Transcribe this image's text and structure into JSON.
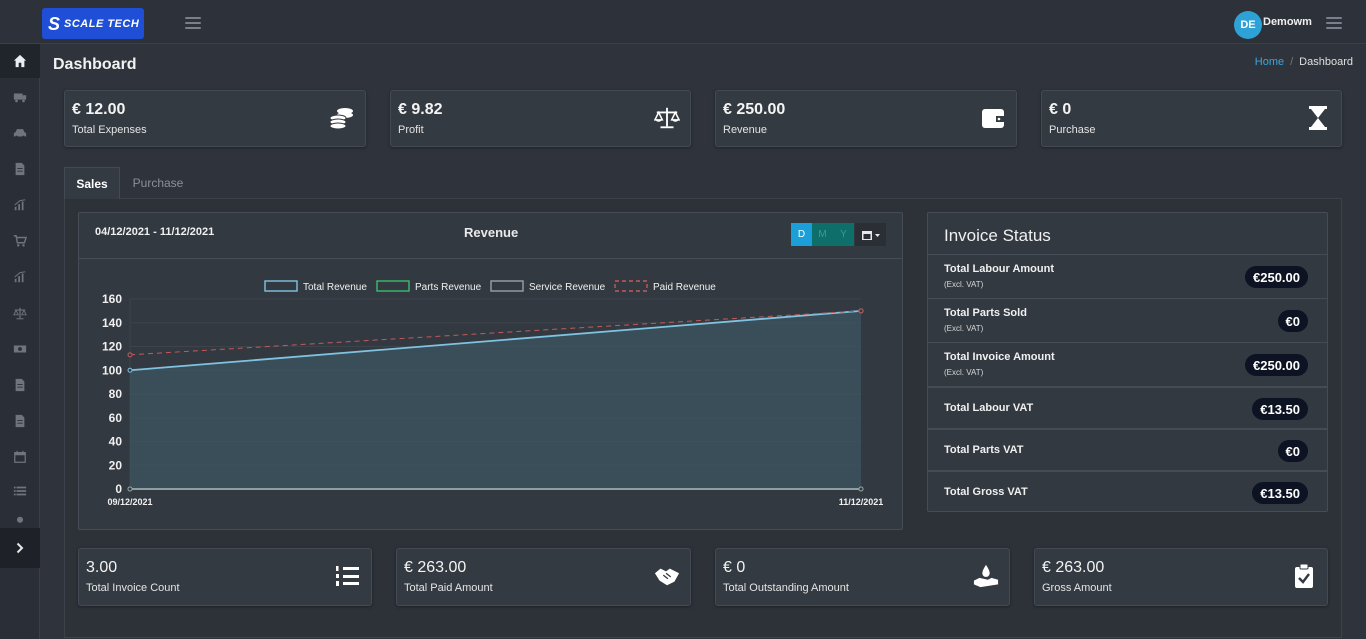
{
  "brand": {
    "name": "SCALE TECH",
    "mark": "S"
  },
  "user": {
    "initials": "DE",
    "name": "Demowm"
  },
  "page": {
    "title": "Dashboard"
  },
  "breadcrumb": {
    "home": "Home",
    "separator": "/",
    "current": "Dashboard"
  },
  "stats_top": [
    {
      "value": "€ 12.00",
      "label": "Total Expenses",
      "icon": "coins-icon"
    },
    {
      "value": "€ 9.82",
      "label": "Profit",
      "icon": "balance-scale-icon"
    },
    {
      "value": "€ 250.00",
      "label": "Revenue",
      "icon": "wallet-icon"
    },
    {
      "value": "€ 0",
      "label": "Purchase",
      "icon": "hourglass-icon"
    }
  ],
  "tabs": [
    {
      "label": "Sales",
      "active": true
    },
    {
      "label": "Purchase",
      "active": false
    }
  ],
  "revenue_card": {
    "date_range": "04/12/2021 - 11/12/2021",
    "title": "Revenue",
    "period_buttons": [
      "D",
      "M",
      "Y"
    ],
    "selected_period": "D"
  },
  "chart_data": {
    "type": "line",
    "title": "Revenue",
    "x": [
      "09/12/2021",
      "11/12/2021"
    ],
    "ylim": [
      0,
      160
    ],
    "yticks": [
      0,
      20,
      40,
      60,
      80,
      100,
      120,
      140,
      160
    ],
    "grid": true,
    "legend": "top",
    "series": [
      {
        "name": "Total Revenue",
        "values": [
          100,
          150
        ],
        "color": "#7fc3e0",
        "style": "solid",
        "fill": true
      },
      {
        "name": "Parts Revenue",
        "values": [
          0,
          0
        ],
        "color": "#3dbb6e",
        "style": "solid",
        "fill": false
      },
      {
        "name": "Service Revenue",
        "values": [
          0,
          0
        ],
        "color": "#9aa0a8",
        "style": "solid",
        "fill": false
      },
      {
        "name": "Paid Revenue",
        "values": [
          113,
          150
        ],
        "color": "#c25a5a",
        "style": "dashed",
        "fill": false
      }
    ]
  },
  "invoice_status": {
    "title": "Invoice Status",
    "rows": [
      {
        "label": "Total Labour Amount",
        "sub": "(Excl. VAT)",
        "value": "€250.00"
      },
      {
        "label": "Total Parts Sold",
        "sub": "(Excl. VAT)",
        "value": "€0"
      },
      {
        "label": "Total Invoice Amount",
        "sub": "(Excl. VAT)",
        "value": "€250.00"
      },
      {
        "label": "Total Labour VAT",
        "sub": "",
        "value": "€13.50"
      },
      {
        "label": "Total Parts VAT",
        "sub": "",
        "value": "€0"
      },
      {
        "label": "Total Gross VAT",
        "sub": "",
        "value": "€13.50"
      }
    ]
  },
  "stats_bottom": [
    {
      "value": "3.00",
      "label": "Total Invoice Count",
      "icon": "numbered-list-icon"
    },
    {
      "value": "€ 263.00",
      "label": "Total Paid Amount",
      "icon": "handshake-icon"
    },
    {
      "value": "€ 0",
      "label": "Total Outstanding Amount",
      "icon": "hand-holding-drop-icon"
    },
    {
      "value": "€ 263.00",
      "label": "Gross Amount",
      "icon": "clipboard-check-icon"
    }
  ],
  "sidebar_icons": [
    "home-icon",
    "truck-icon",
    "car-icon",
    "document-icon",
    "chart-icon",
    "cart-icon",
    "chart-icon",
    "balance-icon",
    "money-icon",
    "document-icon",
    "document-icon",
    "calendar-icon",
    "list-icon",
    "user-icon"
  ],
  "colors": {
    "accent": "#1a9fd9",
    "brand": "#1f4fd6",
    "badge": "#0d1322",
    "background": "#2f333b"
  }
}
